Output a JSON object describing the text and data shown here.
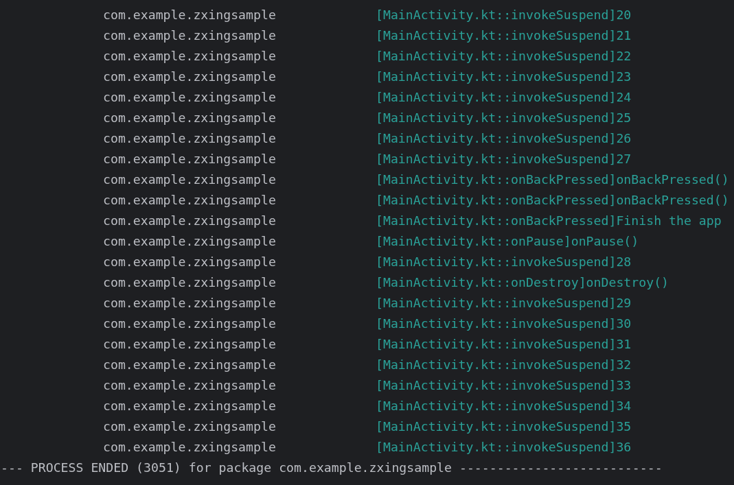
{
  "log_lines": [
    {
      "package": "com.example.zxingsample",
      "message": "[MainActivity.kt::invokeSuspend]20"
    },
    {
      "package": "com.example.zxingsample",
      "message": "[MainActivity.kt::invokeSuspend]21"
    },
    {
      "package": "com.example.zxingsample",
      "message": "[MainActivity.kt::invokeSuspend]22"
    },
    {
      "package": "com.example.zxingsample",
      "message": "[MainActivity.kt::invokeSuspend]23"
    },
    {
      "package": "com.example.zxingsample",
      "message": "[MainActivity.kt::invokeSuspend]24"
    },
    {
      "package": "com.example.zxingsample",
      "message": "[MainActivity.kt::invokeSuspend]25"
    },
    {
      "package": "com.example.zxingsample",
      "message": "[MainActivity.kt::invokeSuspend]26"
    },
    {
      "package": "com.example.zxingsample",
      "message": "[MainActivity.kt::invokeSuspend]27"
    },
    {
      "package": "com.example.zxingsample",
      "message": "[MainActivity.kt::onBackPressed]onBackPressed()"
    },
    {
      "package": "com.example.zxingsample",
      "message": "[MainActivity.kt::onBackPressed]onBackPressed()"
    },
    {
      "package": "com.example.zxingsample",
      "message": "[MainActivity.kt::onBackPressed]Finish the app"
    },
    {
      "package": "com.example.zxingsample",
      "message": "[MainActivity.kt::onPause]onPause()"
    },
    {
      "package": "com.example.zxingsample",
      "message": "[MainActivity.kt::invokeSuspend]28"
    },
    {
      "package": "com.example.zxingsample",
      "message": "[MainActivity.kt::onDestroy]onDestroy()"
    },
    {
      "package": "com.example.zxingsample",
      "message": "[MainActivity.kt::invokeSuspend]29"
    },
    {
      "package": "com.example.zxingsample",
      "message": "[MainActivity.kt::invokeSuspend]30"
    },
    {
      "package": "com.example.zxingsample",
      "message": "[MainActivity.kt::invokeSuspend]31"
    },
    {
      "package": "com.example.zxingsample",
      "message": "[MainActivity.kt::invokeSuspend]32"
    },
    {
      "package": "com.example.zxingsample",
      "message": "[MainActivity.kt::invokeSuspend]33"
    },
    {
      "package": "com.example.zxingsample",
      "message": "[MainActivity.kt::invokeSuspend]34"
    },
    {
      "package": "com.example.zxingsample",
      "message": "[MainActivity.kt::invokeSuspend]35"
    },
    {
      "package": "com.example.zxingsample",
      "message": "[MainActivity.kt::invokeSuspend]36"
    }
  ],
  "status_line": "--- PROCESS ENDED (3051) for package com.example.zxingsample ---------------------------"
}
